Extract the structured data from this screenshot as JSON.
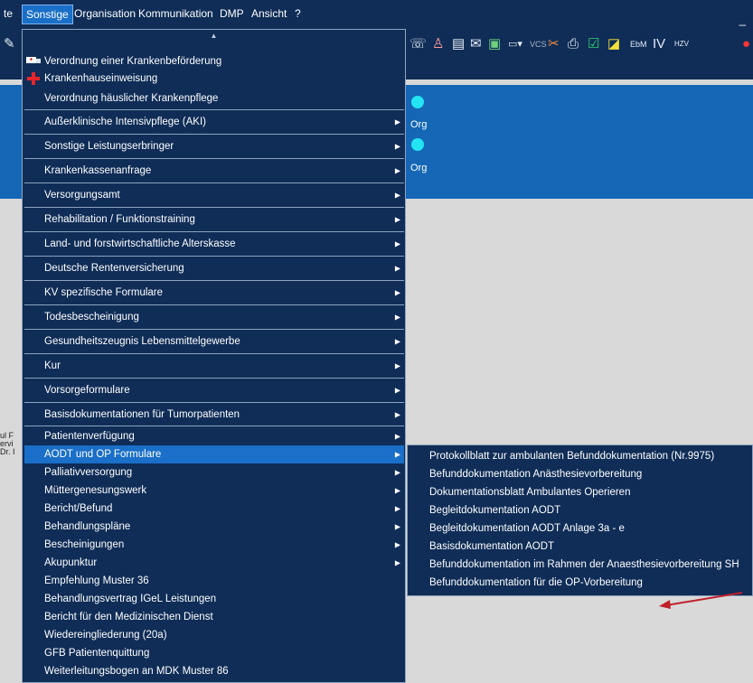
{
  "menubar": {
    "items": [
      "te",
      "Sonstige",
      "Organisation",
      "Kommunikation",
      "DMP",
      "Ansicht",
      "?"
    ],
    "active": "Sonstige"
  },
  "toolbar": {
    "icons": [
      "stethoscope-icon",
      "clock-phone-icon",
      "person-icon",
      "document-icon",
      "mail-icon",
      "image-icon",
      "visa-icon",
      "vcs-label",
      "tools-icon",
      "printer-icon",
      "green-check-icon",
      "pen-icon",
      "ebm-icon",
      "iv-icon",
      "hzv-icon",
      "red-badge-icon"
    ],
    "vcs_label": "VCS",
    "ebm_label": "EbM",
    "iv_label": "IV",
    "hzv_label": "HZV"
  },
  "window": {
    "minimize": "_"
  },
  "panel": {
    "org_labels": [
      "Org",
      "Org"
    ]
  },
  "side_fragments": [
    "ul F",
    "ervi",
    "Dr. I"
  ],
  "menu": {
    "items": [
      {
        "label": "Verordnung einer Krankenbeförderung",
        "icon": "ambulance-icon",
        "submenu": false
      },
      {
        "label": "Krankenhauseinweisung",
        "icon": "red-cross-icon",
        "submenu": false
      },
      {
        "label": "Verordnung häuslicher Krankenpflege",
        "submenu": false
      },
      {
        "label": "Außerklinische Intensivpflege (AKI)",
        "submenu": true
      },
      {
        "label": "Sonstige Leistungserbringer",
        "submenu": true
      },
      {
        "label": "Krankenkassenanfrage",
        "submenu": true
      },
      {
        "label": "Versorgungsamt",
        "submenu": true
      },
      {
        "label": "Rehabilitation / Funktionstraining",
        "submenu": true
      },
      {
        "label": "Land- und forstwirtschaftliche Alterskasse",
        "submenu": true
      },
      {
        "label": "Deutsche Rentenversicherung",
        "submenu": true
      },
      {
        "label": "KV spezifische Formulare",
        "submenu": true
      },
      {
        "label": "Todesbescheinigung",
        "submenu": true
      },
      {
        "label": "Gesundheitszeugnis Lebensmittelgewerbe",
        "submenu": true
      },
      {
        "label": "Kur",
        "submenu": true
      },
      {
        "label": "Vorsorgeformulare",
        "submenu": true
      },
      {
        "label": "Basisdokumentationen für Tumorpatienten",
        "submenu": true
      },
      {
        "label": "Patientenverfügung",
        "submenu": true
      },
      {
        "label": "AODT und OP Formulare",
        "submenu": true,
        "highlighted": true
      },
      {
        "label": "Palliativversorgung",
        "submenu": true
      },
      {
        "label": "Müttergenesungswerk",
        "submenu": true
      },
      {
        "label": "Bericht/Befund",
        "submenu": true
      },
      {
        "label": "Behandlungspläne",
        "submenu": true
      },
      {
        "label": "Bescheinigungen",
        "submenu": true
      },
      {
        "label": "Akupunktur",
        "submenu": true
      },
      {
        "label": "Empfehlung Muster 36",
        "submenu": false
      },
      {
        "label": "Behandlungsvertrag IGeL Leistungen",
        "submenu": false
      },
      {
        "label": "Bericht für den Medizinischen Dienst",
        "submenu": false
      },
      {
        "label": "Wiedereingliederung (20a)",
        "submenu": false
      },
      {
        "label": "GFB Patientenquittung",
        "submenu": false
      },
      {
        "label": "Weiterleitungsbogen an MDK Muster 86",
        "submenu": false
      }
    ]
  },
  "submenu": {
    "items": [
      "Protokollblatt zur ambulanten Befunddokumentation (Nr.9975)",
      "Befunddokumentation Anästhesievorbereitung",
      "Dokumentationsblatt Ambulantes Operieren",
      "Begleitdokumentation AODT",
      "Begleitdokumentation AODT Anlage 3a - e",
      "Basisdokumentation AODT",
      "Befunddokumentation im Rahmen der Anaesthesievorbereitung SH",
      "Befunddokumentation für die OP-Vorbereitung"
    ]
  },
  "annotation": {
    "arrow_color": "#c0202a"
  }
}
